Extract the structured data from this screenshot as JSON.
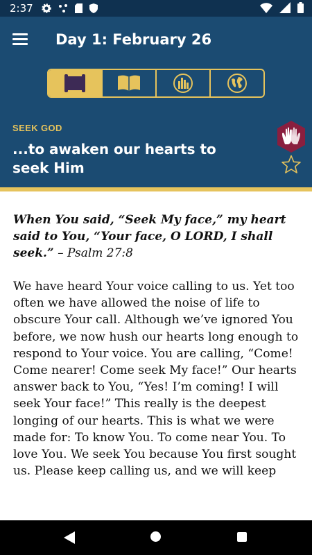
{
  "status_bar": {
    "time": "2:37"
  },
  "app_bar": {
    "title": "Day 1: February 26"
  },
  "tabs": [
    {
      "name": "scroll",
      "active": true
    },
    {
      "name": "book",
      "active": false
    },
    {
      "name": "city",
      "active": false
    },
    {
      "name": "globe",
      "active": false
    }
  ],
  "header": {
    "eyebrow": "SEEK GOD",
    "subtitle": "...to awaken our hearts to seek Him"
  },
  "content": {
    "verse": "When You said, “Seek My face,” my heart said to You, “Your face, O LORD, I shall seek.”",
    "verse_ref": " – Psalm 27:8",
    "body": "We have heard Your voice calling to us. Yet too often we have allowed the noise of life to obscure Your call. Although we’ve ignored You before, we now hush our hearts long enough to respond to Your voice. You are calling, “Come! Come nearer! Come seek My face!” Our hearts answer back to You, “Yes! I’m coming! I will seek Your face!” This really is the deepest longing of our hearts. This is what we were made for: To know You. To come near You. To love You. We seek You because You first sought us. Please keep calling us, and we will keep"
  },
  "colors": {
    "primary": "#1b4b72",
    "status_bar": "#0f3150",
    "accent": "#e6c35c",
    "badge": "#8a1f3f"
  }
}
